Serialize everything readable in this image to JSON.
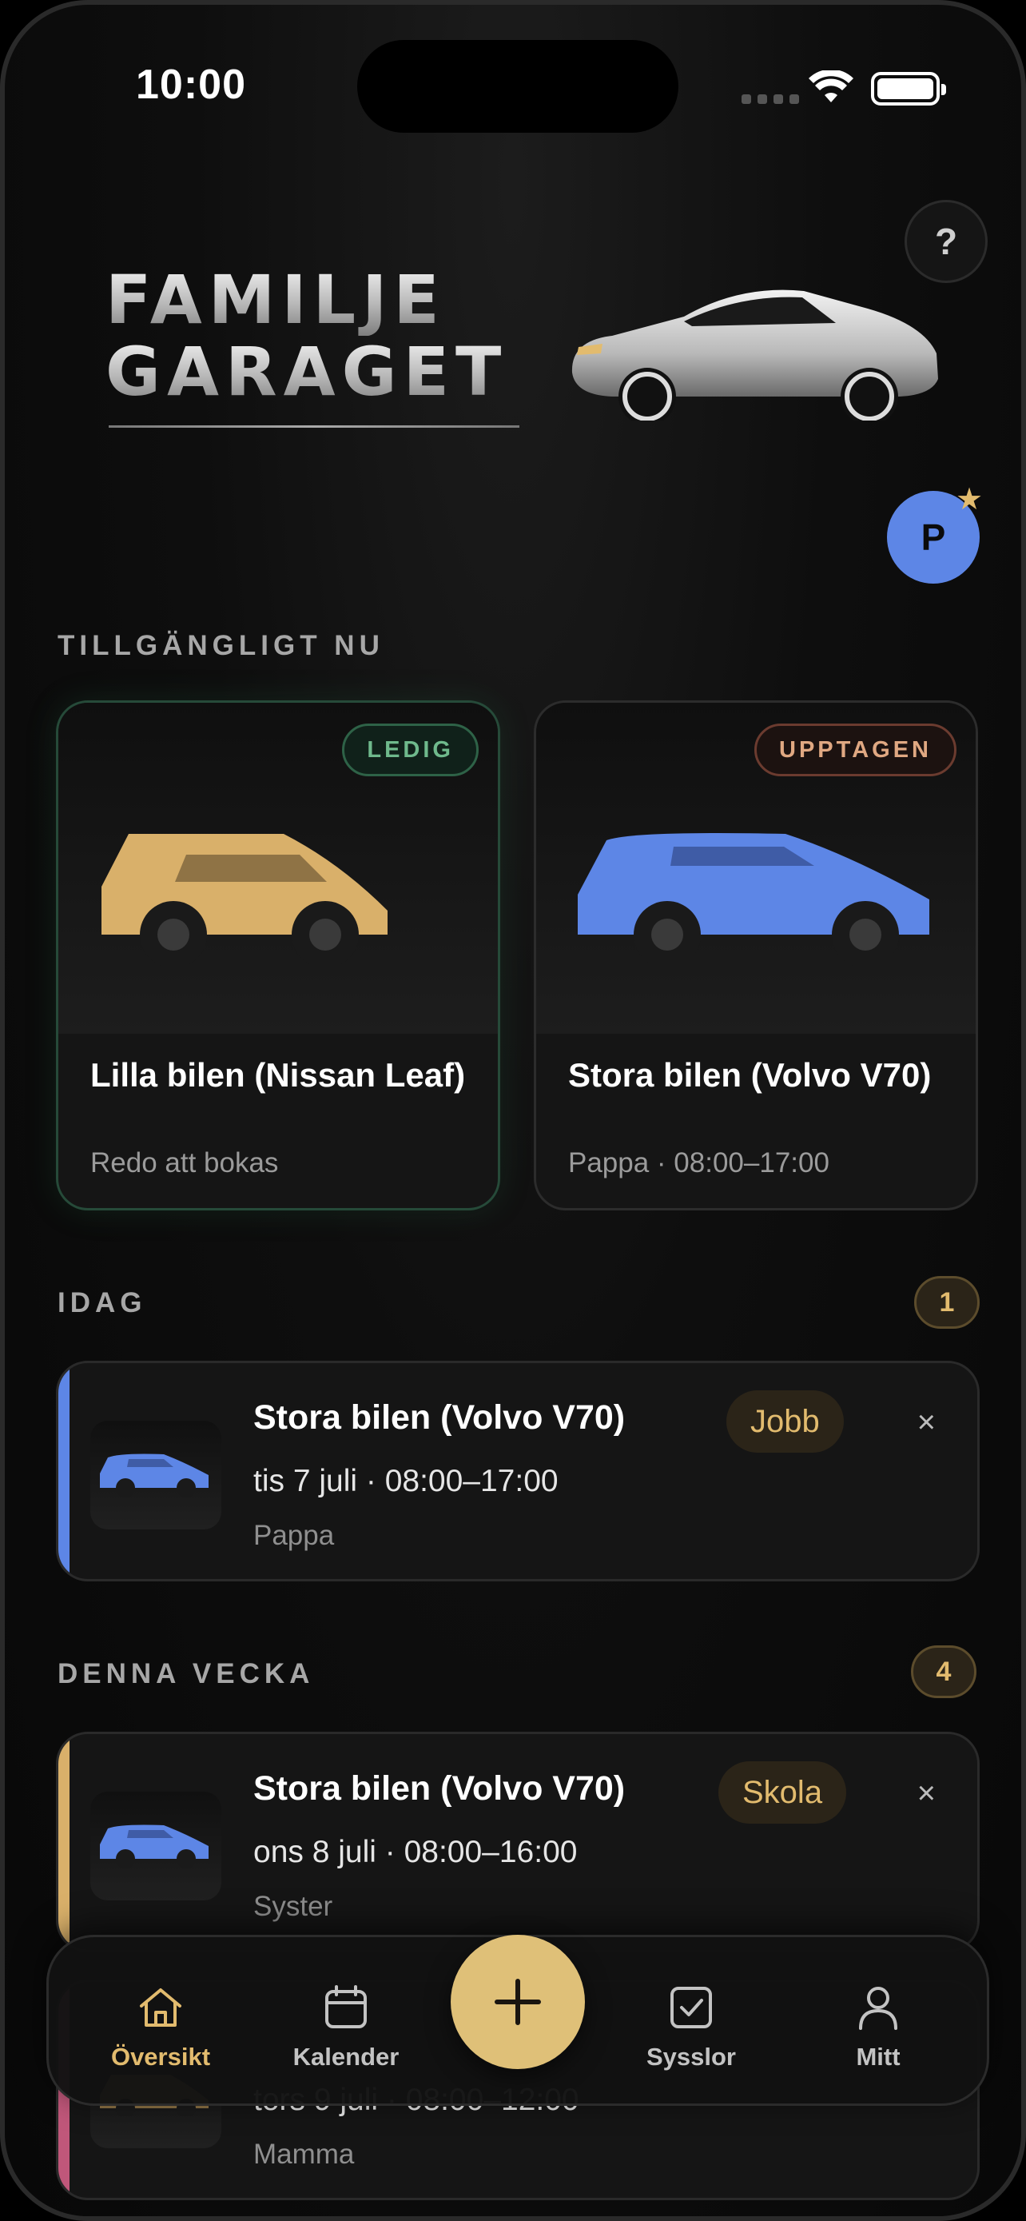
{
  "status_bar": {
    "time": "10:00"
  },
  "header": {
    "help_label": "?",
    "logo_line1": "FAMILJE",
    "logo_line2": "GARAGET"
  },
  "user": {
    "avatar_initial": "P",
    "star": "★"
  },
  "available_section": {
    "title": "TILLGÄNGLIGT NU",
    "cars": [
      {
        "status": "LEDIG",
        "name": "Lilla bilen (Nissan Leaf)",
        "subtitle": "Redo att bokas",
        "color": "#d9b06a"
      },
      {
        "status": "UPPTAGEN",
        "name": "Stora bilen (Volvo V70)",
        "subtitle": "Pappa · 08:00–17:00",
        "color": "#5d86e6"
      }
    ]
  },
  "today_section": {
    "title": "IDAG",
    "count": "1",
    "bookings": [
      {
        "title": "Stora bilen (Volvo V70)",
        "tag": "Jobb",
        "when": "tis 7 juli · 08:00–17:00",
        "who": "Pappa",
        "accent": "#5d86e6",
        "close": "×"
      }
    ]
  },
  "week_section": {
    "title": "DENNA VECKA",
    "count": "4",
    "bookings": [
      {
        "title": "Stora bilen (Volvo V70)",
        "tag": "Skola",
        "when": "ons 8 juli · 08:00–16:00",
        "who": "Syster",
        "accent": "#d9b06a",
        "close": "×"
      },
      {
        "title": "",
        "tag": "",
        "when": "tors 9 juli · 08:00–12:00",
        "who": "Mamma",
        "accent": "#c0577a",
        "close": ""
      }
    ]
  },
  "bottom_nav": {
    "items": [
      {
        "label": "Översikt",
        "icon": "home-icon",
        "active": true
      },
      {
        "label": "Kalender",
        "icon": "calendar-icon",
        "active": false
      },
      {
        "label": "Sysslor",
        "icon": "checkbox-icon",
        "active": false
      },
      {
        "label": "Mitt",
        "icon": "user-icon",
        "active": false
      }
    ],
    "fab_icon": "plus-icon"
  },
  "colors": {
    "accent_gold": "#e2bb6e",
    "free_green": "#6fb98c",
    "busy_orange": "#e0a882",
    "card_bg": "#151515"
  }
}
